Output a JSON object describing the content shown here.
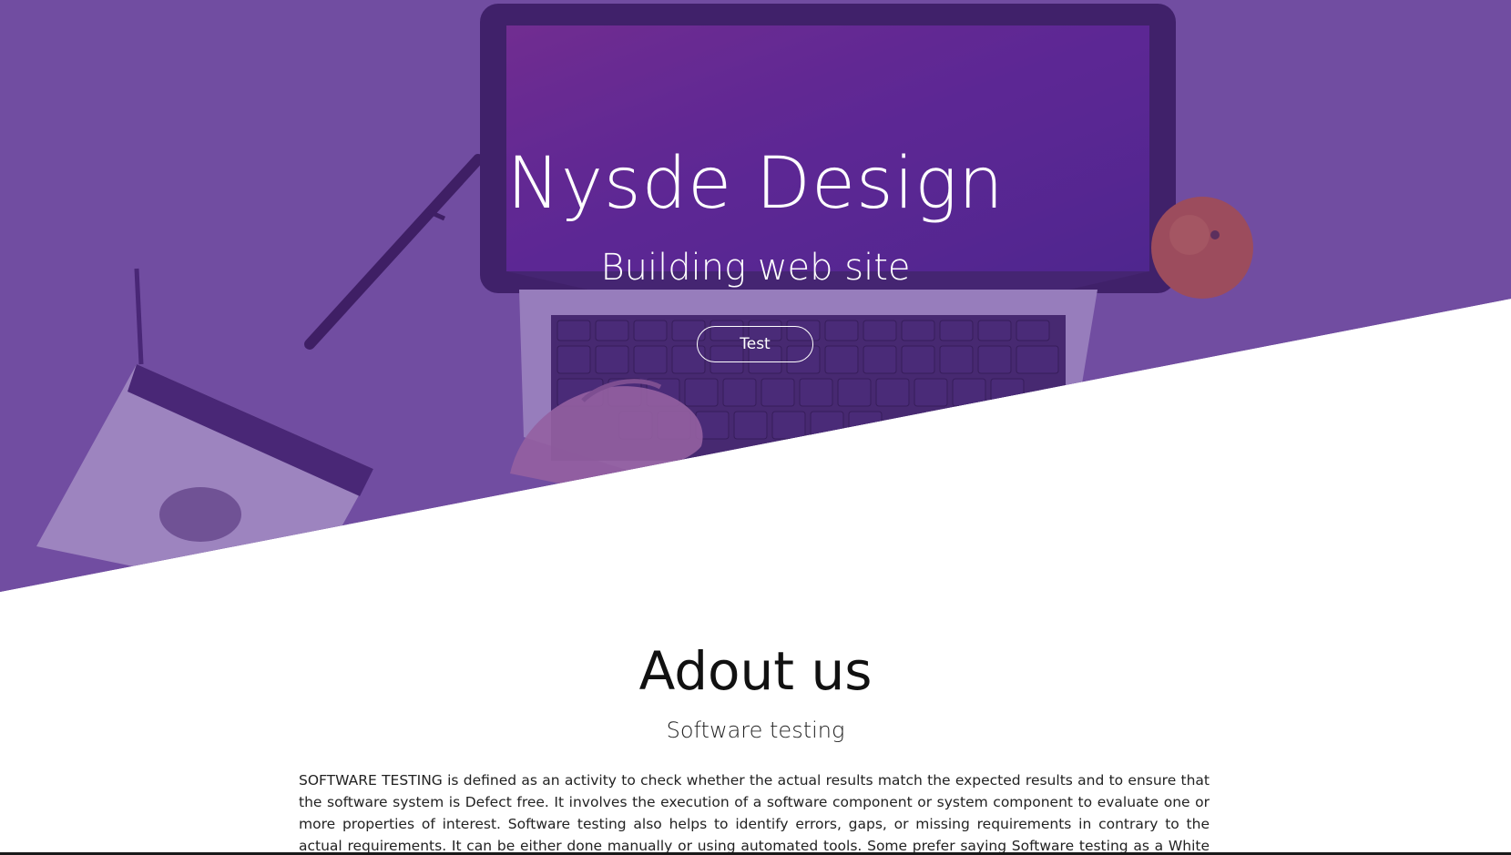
{
  "hero": {
    "title": "Nysde Design",
    "subtitle": "Building web site",
    "button_label": "Test",
    "overlay_color": "#6c4b98"
  },
  "about": {
    "title": "Adout us",
    "subtitle": "Software testing",
    "text": "SOFTWARE TESTING is defined as an activity to check whether the actual results match the expected results and to ensure that the software system is Defect free. It involves the execution of a software component or system component to evaluate one or more properties of interest. Software testing also helps to identify errors, gaps, or missing requirements in contrary to the actual requirements. It can be either done manually or using automated tools. Some prefer saying Software testing as a White Box and Black Box Testing."
  }
}
